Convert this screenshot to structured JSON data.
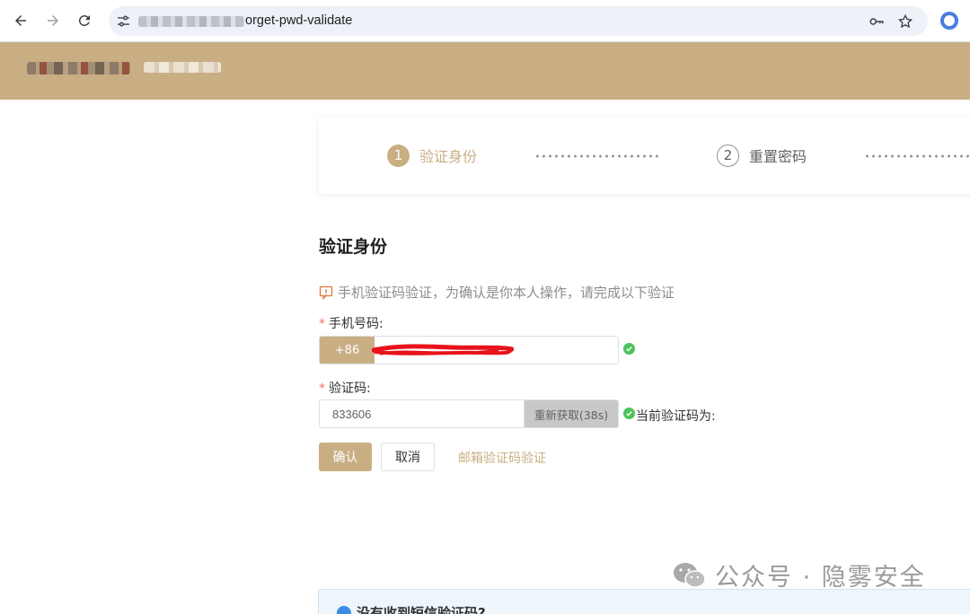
{
  "browser": {
    "url_visible": "orget-pwd-validate"
  },
  "steps": [
    {
      "number": "1",
      "label": "验证身份"
    },
    {
      "number": "2",
      "label": "重置密码"
    }
  ],
  "section": {
    "title": "验证身份",
    "notice": "手机验证码验证，为确认是你本人操作，请完成以下验证"
  },
  "form": {
    "phone_label": "手机号码:",
    "phone_prefix": "+86",
    "phone_value": "",
    "code_label": "验证码:",
    "code_value": "833606",
    "resend_label": "重新获取(38s)",
    "current_code_label": "当前验证码为:",
    "required_mark": "*"
  },
  "actions": {
    "confirm": "确认",
    "cancel": "取消",
    "email_verify": "邮箱验证码验证"
  },
  "watermark": "公众号 · 隐雾安全",
  "info_box_title": "没有收到短信验证码?",
  "colors": {
    "accent": "#c9ae84",
    "success": "#4cc35a",
    "required": "#f56c6c",
    "info": "#3e8be5"
  }
}
